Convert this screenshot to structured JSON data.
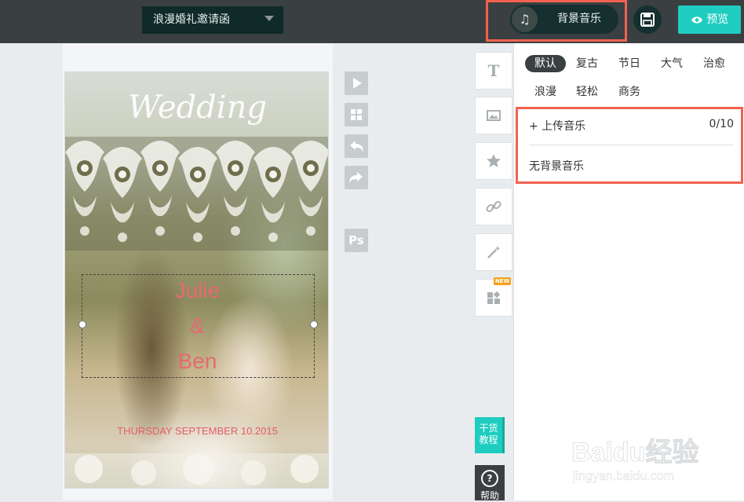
{
  "header": {
    "project_title": "浪漫婚礼邀请函",
    "music_button_label": "背景音乐",
    "preview_label": "预览"
  },
  "canvas": {
    "wedding_word": "Wedding",
    "name_line_1": "Julie",
    "name_line_2": "&",
    "name_line_3": "Ben",
    "date_line": "THURSDAY SEPTEMBER 10.2015"
  },
  "toolbar": {
    "text_tool_glyph": "T",
    "new_badge": "NEW",
    "ps_label": "Ps"
  },
  "music_panel": {
    "categories": [
      "默认",
      "复古",
      "节日",
      "大气",
      "治愈",
      "浪漫",
      "轻松",
      "商务"
    ],
    "active_category": "默认",
    "upload_label": "+ 上传音乐",
    "upload_count": "0/10",
    "no_music_label": "无背景音乐"
  },
  "side_tabs": {
    "guide_label_1": "干货",
    "guide_label_2": "教程",
    "help_label": "帮助"
  },
  "watermark": {
    "brand": "Baidu经验",
    "url": "jingyan.baidu.com"
  },
  "colors": {
    "topbar": "#3a3f42",
    "accent": "#1fcdc0",
    "highlight_frame": "#f0624f",
    "name_pink": "#e66a72"
  }
}
